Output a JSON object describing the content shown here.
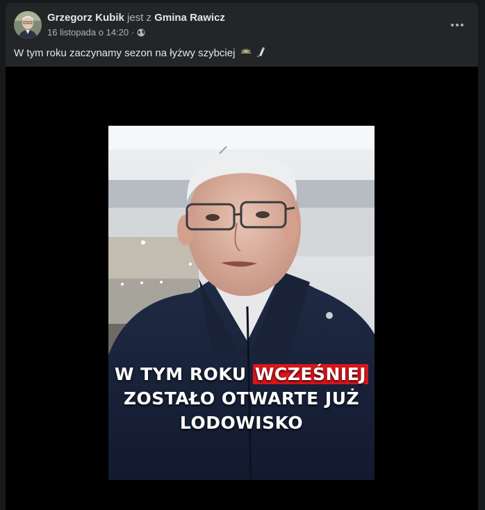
{
  "post": {
    "author_name": "Grzegorz Kubik",
    "with_text": "jest z",
    "place": "Gmina Rawicz",
    "date": "16 listopada o 14:20",
    "separator": "·",
    "audience_icon": "globe-icon",
    "text": "W tym roku zaczynamy sezon na łyżwy szybciej",
    "emojis": [
      "ice-skate-emoji",
      "skate-blade-emoji"
    ]
  },
  "video": {
    "caption_line1_pre": "W TYM ROKU",
    "caption_line1_highlight": "WCZEŚNIEJ",
    "caption_line2": "ZOSTAŁO OTWARTE JUŻ",
    "caption_line3": "LODOWISKO",
    "highlight_color": "#d9161c"
  },
  "colors": {
    "page_bg": "#18191a",
    "card_bg": "#242526",
    "primary_text": "#e4e6eb",
    "secondary_text": "#b0b3b8"
  }
}
